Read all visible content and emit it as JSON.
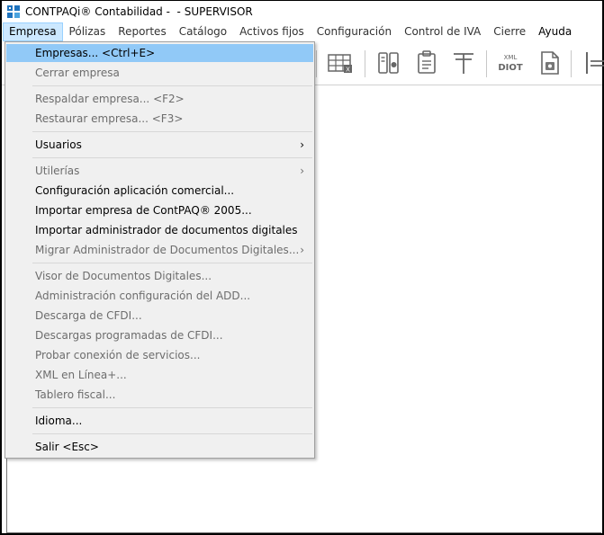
{
  "window": {
    "title": "CONTPAQi® Contabilidad -  - SUPERVISOR",
    "app_icon": "contpaqi-app-icon"
  },
  "menubar": {
    "items": [
      {
        "label": "Empresa"
      },
      {
        "label": "Pólizas"
      },
      {
        "label": "Reportes"
      },
      {
        "label": "Catálogo"
      },
      {
        "label": "Activos fijos"
      },
      {
        "label": "Configuración"
      },
      {
        "label": "Control de IVA"
      },
      {
        "label": "Cierre"
      },
      {
        "label": "Ayuda"
      }
    ]
  },
  "toolbar": {
    "diot_label_top": "XML",
    "diot_label_bottom": "DIOT",
    "icons": [
      "spreadsheet-icon",
      "document-compare-icon",
      "clipboard-icon",
      "tax-t-icon",
      "xml-diot-icon",
      "xml-document-icon",
      "split-icon"
    ]
  },
  "dropdown": {
    "items": [
      {
        "label": "Empresas... <Ctrl+E>",
        "enabled": true,
        "highlighted": true
      },
      {
        "label": "Cerrar empresa",
        "enabled": false
      },
      {
        "label": "Respaldar empresa... <F2>",
        "enabled": false
      },
      {
        "label": "Restaurar empresa... <F3>",
        "enabled": false
      },
      {
        "label": "Usuarios",
        "enabled": true,
        "submenu": true
      },
      {
        "label": "Utilerías",
        "enabled": false,
        "submenu": true
      },
      {
        "label": "Configuración aplicación comercial...",
        "enabled": true
      },
      {
        "label": "Importar empresa de ContPAQ® 2005...",
        "enabled": true
      },
      {
        "label": "Importar administrador de documentos digitales",
        "enabled": true
      },
      {
        "label": "Migrar Administrador de Documentos Digitales...",
        "enabled": false,
        "submenu": true
      },
      {
        "label": "Visor de Documentos Digitales...",
        "enabled": false
      },
      {
        "label": "Administración configuración del ADD...",
        "enabled": false
      },
      {
        "label": "Descarga de CFDI...",
        "enabled": false
      },
      {
        "label": "Descargas programadas de CFDI...",
        "enabled": false
      },
      {
        "label": "Probar conexión de servicios...",
        "enabled": false
      },
      {
        "label": "XML en Línea+...",
        "enabled": false
      },
      {
        "label": "Tablero fiscal...",
        "enabled": false
      },
      {
        "label": "Idioma...",
        "enabled": true
      },
      {
        "label": "Salir <Esc>",
        "enabled": true
      }
    ],
    "submenu_arrow": "›"
  },
  "colors": {
    "highlight": "#91c9f7",
    "menu_active": "#cce8ff",
    "disabled_text": "#6d6d6d",
    "menu_bg": "#f0f0f0"
  }
}
